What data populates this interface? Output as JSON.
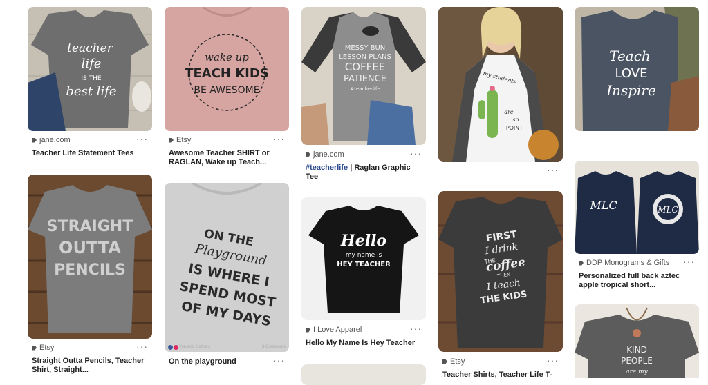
{
  "pins": [
    {
      "source": "jane.com",
      "title": "Teacher Life Statement Tees",
      "shirt_text": [
        "teacher",
        "life",
        "IS THE",
        "best life"
      ]
    },
    {
      "source": "Etsy",
      "title": "Awesome Teacher SHIRT or RAGLAN, Wake up Teach...",
      "shirt_text": [
        "wake up",
        "TEACH KIDS",
        "BE AWESOME"
      ]
    },
    {
      "source": "jane.com",
      "title_link": "#teacherlife",
      "title_rest": " | Raglan Graphic Tee",
      "shirt_text": [
        "MESSY BUN",
        "LESSON PLANS",
        "COFFEE",
        "PATIENCE",
        "#teacherlife"
      ]
    },
    {
      "shirt_text": [
        "my students",
        "are",
        "so",
        "POINT"
      ]
    },
    {
      "shirt_text": [
        "Teach",
        "LOVE",
        "Inspire"
      ]
    },
    {
      "source": "Etsy",
      "title": "Straight Outta Pencils, Teacher Shirt, Straight...",
      "shirt_text": [
        "STRAIGHT",
        "OUTTA",
        "PENCILS"
      ]
    },
    {
      "title": "On the playground",
      "reactions_text": "You and 2 others",
      "comments_text": "3 Comments",
      "shirt_text": [
        "ON THE",
        "Playground",
        "IS WHERE I",
        "SPEND MOST",
        "OF MY DAYS"
      ]
    },
    {
      "source": "I Love Apparel",
      "title": "Hello My Name Is Hey Teacher",
      "shirt_text": [
        "Hello",
        "my name is",
        "HEY TEACHER"
      ]
    },
    {
      "source": "Etsy",
      "title": "Teacher Shirts, Teacher Life T-",
      "shirt_text": [
        "FIRST",
        "I drink",
        "THE",
        "coffee",
        "THEN",
        "I teach",
        "THE KIDS"
      ]
    },
    {
      "source": "DDP Monograms & Gifts",
      "title": "Personalized full back aztec apple tropical short...",
      "shirt_text": [
        "MLC",
        "MLC"
      ]
    },
    {
      "shirt_text": [
        "KIND",
        "PEOPLE",
        "are my"
      ]
    }
  ],
  "more_label": "···"
}
